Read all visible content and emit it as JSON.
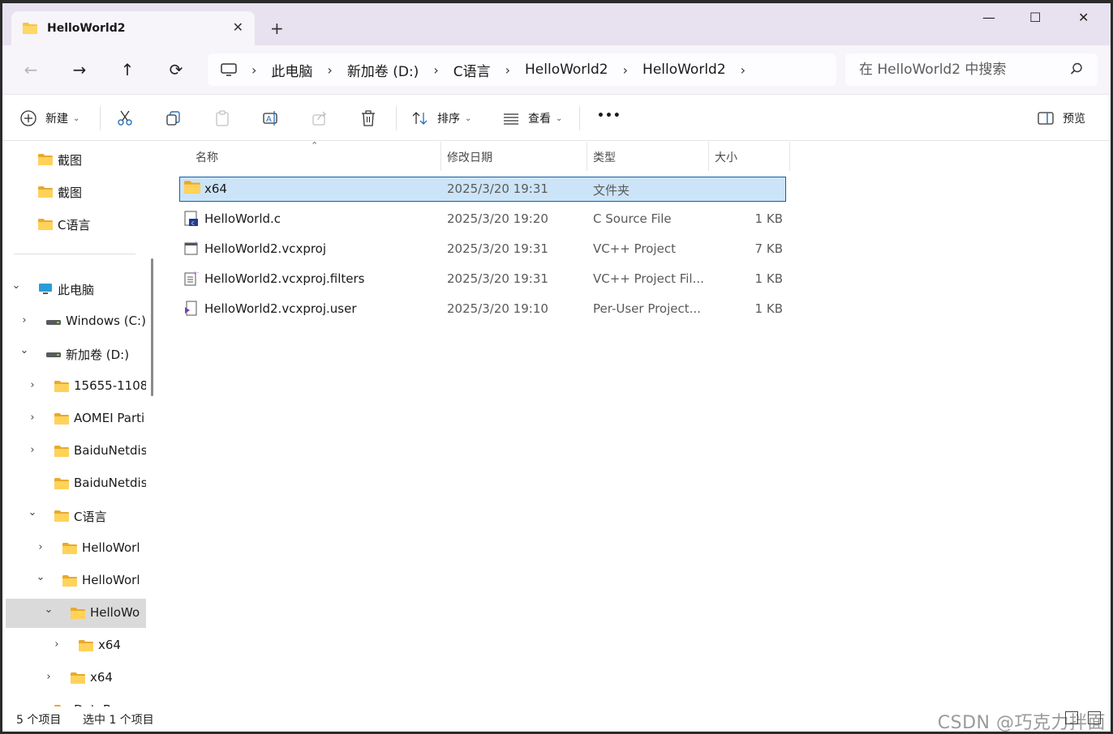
{
  "window": {
    "tab_title": "HelloWorld2",
    "controls": {
      "minimize": "—",
      "maximize": "☐",
      "close": "✕"
    }
  },
  "nav": {
    "breadcrumbs": [
      "此电脑",
      "新加卷 (D:)",
      "C语言",
      "HelloWorld2",
      "HelloWorld2"
    ],
    "search_placeholder": "在 HelloWorld2 中搜索"
  },
  "toolbar": {
    "new_label": "新建",
    "sort_label": "排序",
    "view_label": "查看",
    "more_label": "•••",
    "preview_label": "预览"
  },
  "sidebar": {
    "items": [
      {
        "label": "截图",
        "icon": "folder-icon",
        "indent": 0,
        "chevron": ""
      },
      {
        "label": "截图",
        "icon": "folder-icon",
        "indent": 0,
        "chevron": ""
      },
      {
        "label": "C语言",
        "icon": "folder-icon",
        "indent": 0,
        "chevron": ""
      },
      {
        "label": "此电脑",
        "icon": "pc-icon",
        "indent": 0,
        "chevron": "down"
      },
      {
        "label": "Windows (C:)",
        "icon": "drive-icon",
        "indent": 1,
        "chevron": "right"
      },
      {
        "label": "新加卷 (D:)",
        "icon": "drive-icon",
        "indent": 1,
        "chevron": "down"
      },
      {
        "label": "15655-1108",
        "icon": "folder-icon",
        "indent": 2,
        "chevron": "right"
      },
      {
        "label": "AOMEI Parti",
        "icon": "folder-icon",
        "indent": 2,
        "chevron": "right"
      },
      {
        "label": "BaiduNetdis",
        "icon": "folder-icon",
        "indent": 2,
        "chevron": "right"
      },
      {
        "label": "BaiduNetdis",
        "icon": "folder-icon",
        "indent": 2,
        "chevron": ""
      },
      {
        "label": "C语言",
        "icon": "folder-icon",
        "indent": 2,
        "chevron": "down"
      },
      {
        "label": "HelloWorl",
        "icon": "folder-icon",
        "indent": 3,
        "chevron": "right"
      },
      {
        "label": "HelloWorl",
        "icon": "folder-icon",
        "indent": 3,
        "chevron": "down"
      },
      {
        "label": "HelloWo",
        "icon": "folder-icon",
        "indent": 4,
        "chevron": "down",
        "selected": true
      },
      {
        "label": "x64",
        "icon": "folder-icon",
        "indent": 5,
        "chevron": "right"
      },
      {
        "label": "x64",
        "icon": "folder-icon",
        "indent": 4,
        "chevron": "right"
      },
      {
        "label": "DataBase",
        "icon": "folder-icon",
        "indent": 2,
        "chevron": "right"
      }
    ]
  },
  "list": {
    "columns": [
      "名称",
      "修改日期",
      "类型",
      "大小"
    ],
    "rows": [
      {
        "name": "x64",
        "date": "2025/3/20 19:31",
        "type": "文件夹",
        "size": "",
        "icon": "folder-icon",
        "selected": true
      },
      {
        "name": "HelloWorld.c",
        "date": "2025/3/20 19:20",
        "type": "C Source File",
        "size": "1 KB",
        "icon": "c-file-icon",
        "selected": false
      },
      {
        "name": "HelloWorld2.vcxproj",
        "date": "2025/3/20 19:31",
        "type": "VC++ Project",
        "size": "7 KB",
        "icon": "vcxproj-icon",
        "selected": false
      },
      {
        "name": "HelloWorld2.vcxproj.filters",
        "date": "2025/3/20 19:31",
        "type": "VC++ Project Fil...",
        "size": "1 KB",
        "icon": "filters-file-icon",
        "selected": false
      },
      {
        "name": "HelloWorld2.vcxproj.user",
        "date": "2025/3/20 19:10",
        "type": "Per-User Project...",
        "size": "1 KB",
        "icon": "user-file-icon",
        "selected": false
      }
    ]
  },
  "status": {
    "item_count": "5 个项目",
    "selected_count": "选中 1 个项目",
    "watermark": "CSDN @巧克力拌面"
  },
  "colors": {
    "titlebar": "#e8e2f0",
    "selection": "#cce4f7",
    "selection_border": "#0d5faf",
    "folder": "#f5c542"
  }
}
